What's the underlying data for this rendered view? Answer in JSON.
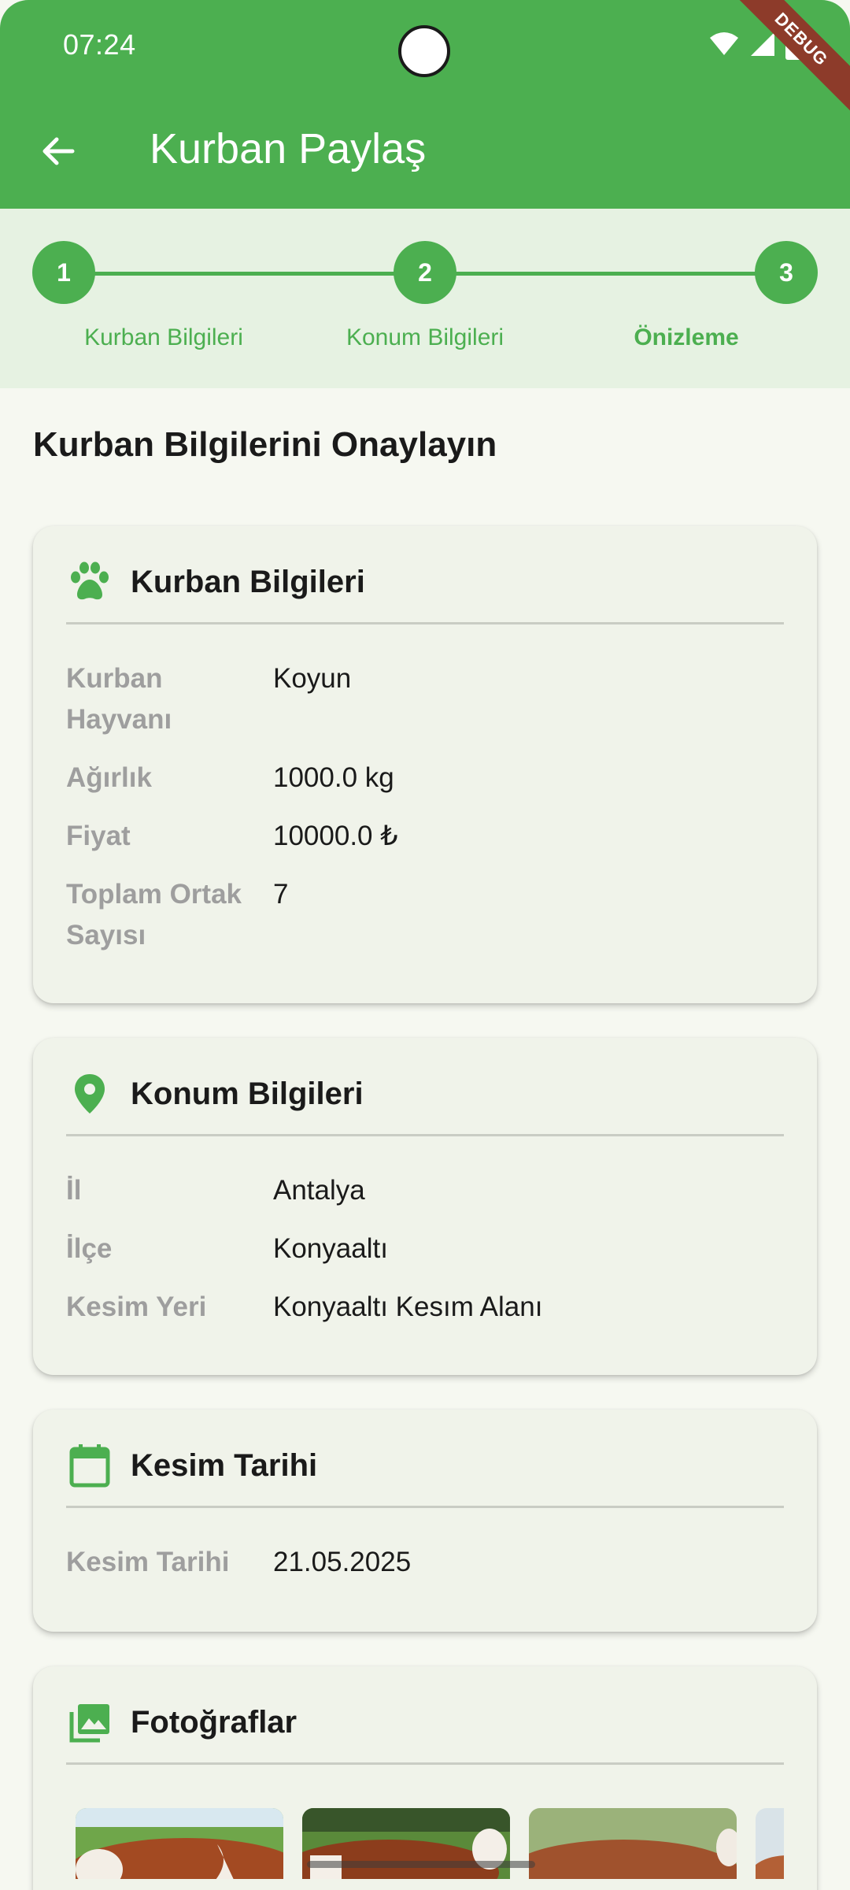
{
  "status_bar": {
    "time": "07:24",
    "debug": "DEBUG"
  },
  "app_bar": {
    "title": "Kurban Paylaş",
    "back_icon": "arrow-left-icon"
  },
  "colors": {
    "primary": "#4caf50",
    "ribbon": "#8d3b2a"
  },
  "stepper": {
    "steps": [
      {
        "number": "1",
        "label": "Kurban Bilgileri"
      },
      {
        "number": "2",
        "label": "Konum Bilgileri"
      },
      {
        "number": "3",
        "label": "Önizleme"
      }
    ]
  },
  "page": {
    "heading": "Kurban Bilgilerini Onaylayın"
  },
  "kurban_card": {
    "title": "Kurban Bilgileri",
    "icon": "paw-icon",
    "rows": [
      {
        "label": "Kurban Hayvanı",
        "value": "Koyun"
      },
      {
        "label": "Ağırlık",
        "value": "1000.0 kg"
      },
      {
        "label": "Fiyat",
        "value": "10000.0 ₺"
      },
      {
        "label": "Toplam Ortak Sayısı",
        "value": "7"
      }
    ]
  },
  "konum_card": {
    "title": "Konum Bilgileri",
    "icon": "location-pin-icon",
    "rows": [
      {
        "label": "İl",
        "value": "Antalya"
      },
      {
        "label": "İlçe",
        "value": "Konyaaltı"
      },
      {
        "label": "Kesim Yeri",
        "value": "Konyaaltı Kesım Alanı"
      }
    ]
  },
  "tarih_card": {
    "title": "Kesim Tarihi",
    "icon": "calendar-icon",
    "rows": [
      {
        "label": "Kesim Tarihi",
        "value": "21.05.2025"
      }
    ]
  },
  "foto_card": {
    "title": "Fotoğraflar",
    "icon": "photo-library-icon"
  }
}
